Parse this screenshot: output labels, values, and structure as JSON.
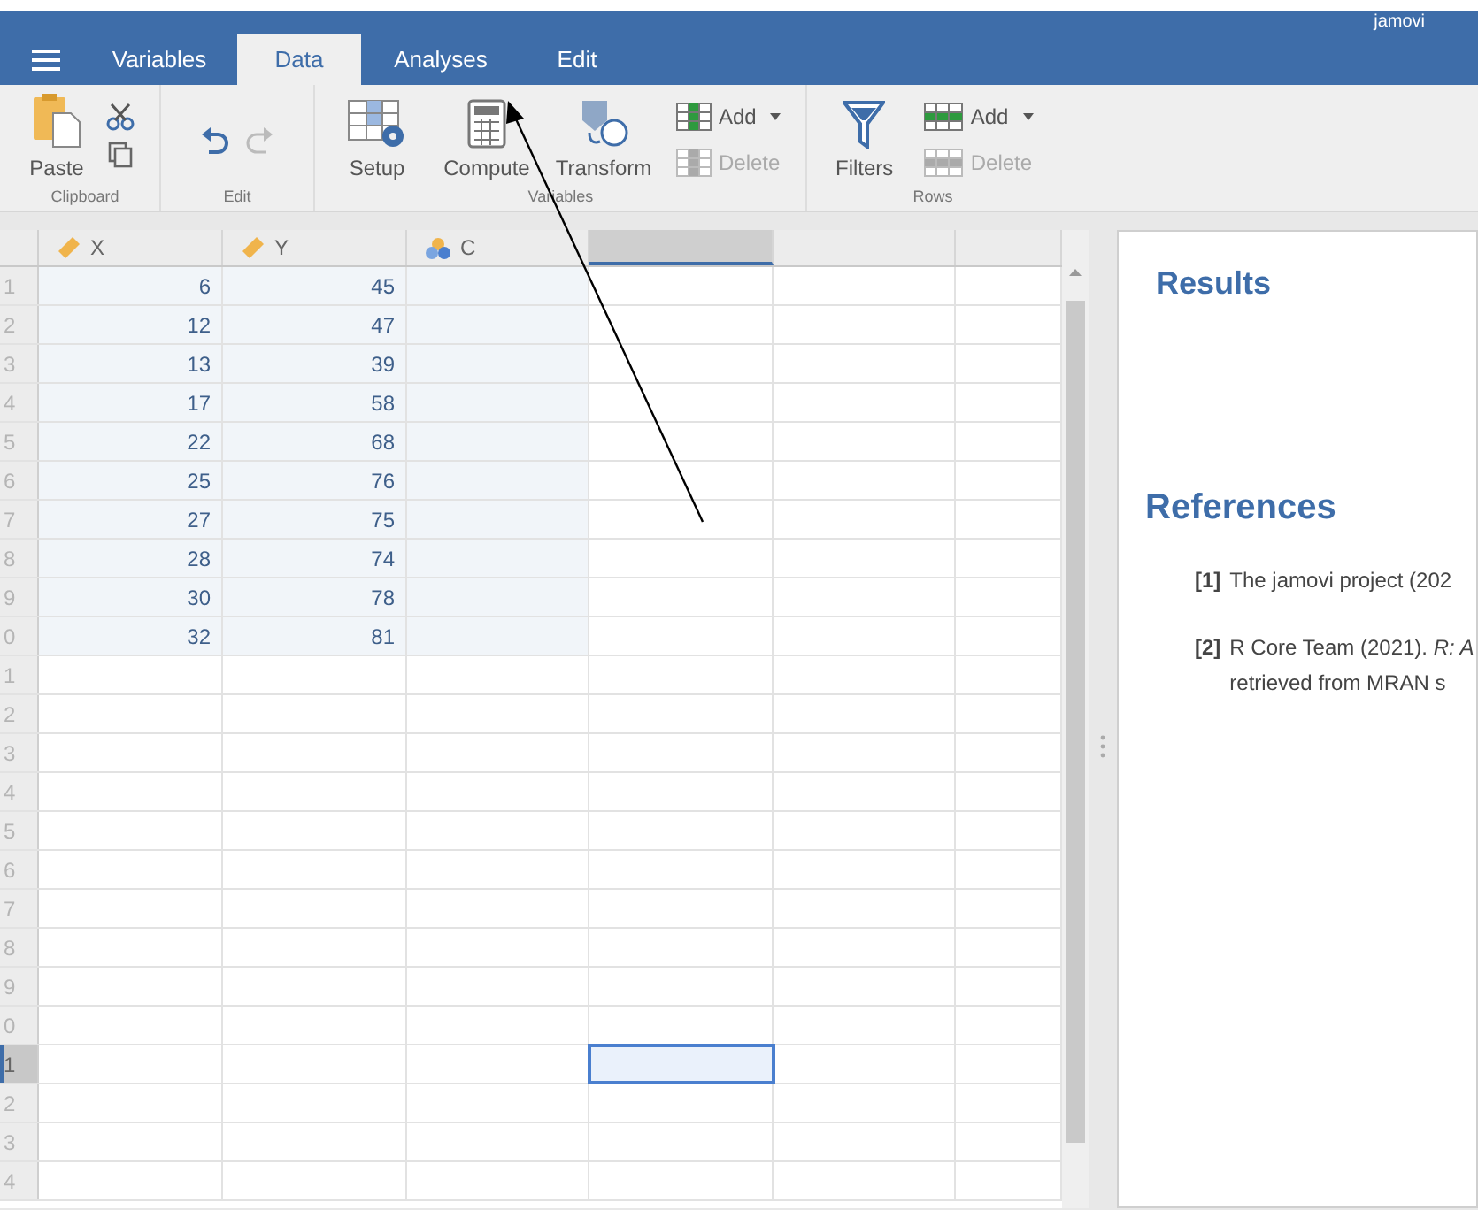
{
  "window": {
    "title": "jamovi"
  },
  "tabs": [
    {
      "label": "Variables",
      "selected": false
    },
    {
      "label": "Data",
      "selected": true
    },
    {
      "label": "Analyses",
      "selected": false
    },
    {
      "label": "Edit",
      "selected": false
    }
  ],
  "toolbar": [
    {
      "label": "Clipboard",
      "tools": [
        {
          "kind": "paste",
          "label": "Paste",
          "disabled": false
        },
        {
          "kind": "cutcopy"
        }
      ]
    },
    {
      "label": "Edit",
      "tools": [
        {
          "kind": "undo",
          "disabled": false
        },
        {
          "kind": "redo",
          "disabled": true
        }
      ]
    },
    {
      "label": "Variables",
      "tools": [
        {
          "kind": "setup",
          "label": "Setup",
          "disabled": false
        },
        {
          "kind": "compute",
          "label": "Compute",
          "disabled": false
        },
        {
          "kind": "transform",
          "label": "Transform",
          "disabled": false
        },
        {
          "kind": "colpair",
          "add": "Add",
          "delete": "Delete",
          "add_disabled": false,
          "delete_disabled": true
        }
      ]
    },
    {
      "label": "Rows",
      "tools": [
        {
          "kind": "filters",
          "label": "Filters",
          "disabled": false
        },
        {
          "kind": "rowpair",
          "add": "Add",
          "delete": "Delete",
          "add_disabled": false,
          "delete_disabled": true
        }
      ]
    }
  ],
  "grid": {
    "columns": [
      {
        "name": "X",
        "kind": "continuous",
        "selected": false
      },
      {
        "name": "Y",
        "kind": "continuous",
        "selected": false
      },
      {
        "name": "C",
        "kind": "nominal",
        "selected": false
      },
      {
        "kind": "empty",
        "selected": true
      },
      {
        "kind": "empty",
        "selected": false
      },
      {
        "kind": "empty",
        "selected": false
      }
    ],
    "rows": [
      {
        "label": "1",
        "cells": [
          "6",
          "45"
        ],
        "selected": false
      },
      {
        "label": "2",
        "cells": [
          "12",
          "47"
        ],
        "selected": false
      },
      {
        "label": "3",
        "cells": [
          "13",
          "39"
        ],
        "selected": false
      },
      {
        "label": "4",
        "cells": [
          "17",
          "58"
        ],
        "selected": false
      },
      {
        "label": "5",
        "cells": [
          "22",
          "68"
        ],
        "selected": false
      },
      {
        "label": "6",
        "cells": [
          "25",
          "76"
        ],
        "selected": false
      },
      {
        "label": "7",
        "cells": [
          "27",
          "75"
        ],
        "selected": false
      },
      {
        "label": "8",
        "cells": [
          "28",
          "74"
        ],
        "selected": false
      },
      {
        "label": "9",
        "cells": [
          "30",
          "78"
        ],
        "selected": false
      },
      {
        "label": "0",
        "cells": [
          "32",
          "81"
        ],
        "selected": false
      },
      {
        "label": "1",
        "selected": false
      },
      {
        "label": "2",
        "selected": false
      },
      {
        "label": "3",
        "selected": false
      },
      {
        "label": "4",
        "selected": false
      },
      {
        "label": "5",
        "selected": false
      },
      {
        "label": "6",
        "selected": false
      },
      {
        "label": "7",
        "selected": false
      },
      {
        "label": "8",
        "selected": false
      },
      {
        "label": "9",
        "selected": false
      },
      {
        "label": "0",
        "selected": false
      },
      {
        "label": "1",
        "selected": true
      },
      {
        "label": "2",
        "selected": false
      },
      {
        "label": "3",
        "selected": false
      },
      {
        "label": "4",
        "selected": false
      }
    ]
  },
  "results": {
    "title": "Results",
    "references_title": "References",
    "references": [
      {
        "number": "[1]",
        "lines": [
          "The jamovi project (202"
        ]
      },
      {
        "number": "[2]",
        "lines": [
          "R Core Team (2021). *R: A*",
          "retrieved from MRAN s"
        ]
      }
    ]
  }
}
